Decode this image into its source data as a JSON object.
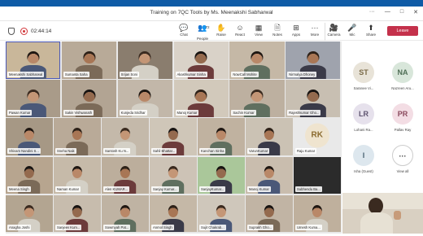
{
  "window": {
    "title": "Training on 7QC Tools by Ms. Meenakshi Sabharwal",
    "controls": [
      "···",
      "—",
      "□",
      "✕"
    ]
  },
  "call": {
    "elapsed": "02:44:14",
    "toolbar": [
      {
        "label": "Chat",
        "icon": "💬"
      },
      {
        "label": "People",
        "icon": "👥",
        "count": "72"
      },
      {
        "label": "Raise",
        "icon": "✋"
      },
      {
        "label": "React",
        "icon": "☺"
      },
      {
        "label": "View",
        "icon": "▦"
      },
      {
        "label": "Notes",
        "icon": "🗎"
      },
      {
        "label": "Apps",
        "icon": "⊞"
      },
      {
        "label": "More",
        "icon": "···"
      },
      {
        "label": "Camera",
        "icon": "🎥"
      },
      {
        "label": "Mic",
        "icon": "🎤"
      },
      {
        "label": "Share",
        "icon": "⬆"
      }
    ],
    "leave_label": "Leave",
    "leave_color": "#c4314b"
  },
  "participants": [
    {
      "name": "Meenakshi Sabharwal",
      "initials": "",
      "bg": "#c9b79a"
    },
    {
      "name": "Sumanta Saha",
      "initials": "",
      "bg": "#b8aa98"
    },
    {
      "name": "Srijan Soni",
      "initials": "",
      "bg": "#8a7d6e"
    },
    {
      "name": "Akashkumar Sinha",
      "initials": "",
      "bg": "#d9d2c8"
    },
    {
      "name": "NowCall Mohite",
      "initials": "",
      "bg": "#c5b8a6"
    },
    {
      "name": "Nirmalya Dhoney",
      "initials": "",
      "bg": "#9fa3ad"
    },
    {
      "name": "Pawan Kumar",
      "initials": "",
      "bg": "#a99b89"
    },
    {
      "name": "Sakin Vishwanath",
      "initials": "",
      "bg": "#b2a493"
    },
    {
      "name": "Kunjeda Sridhar",
      "initials": "",
      "bg": "#c2b7a9"
    },
    {
      "name": "Manoj Kumar",
      "initials": "",
      "bg": "#d2c9bb"
    },
    {
      "name": "Sachin Kumar",
      "initials": "",
      "bg": "#bdb0a0"
    },
    {
      "name": "Rajeshkumar Gho...",
      "initials": "",
      "bg": "#c8bfb2"
    },
    {
      "name": "Shivam Nandini S...",
      "initials": "",
      "bg": "#a69885"
    },
    {
      "name": "Sneha Naik",
      "initials": "",
      "bg": "#b9aa98"
    },
    {
      "name": "Santosh Ku N...",
      "initials": "",
      "bg": "#c4b9aa"
    },
    {
      "name": "Sahil Bhattar...",
      "initials": "",
      "bg": "#cfc6b8"
    },
    {
      "name": "Kanchan Sinha",
      "initials": "",
      "bg": "#c0b2a0"
    },
    {
      "name": "VarunKumar",
      "initials": "",
      "bg": "#cbc2b4"
    },
    {
      "name": "Raju Kumar",
      "initials": "RK",
      "bg": "#e9e9e9"
    },
    {
      "name": "Meena Singh",
      "initials": "",
      "bg": "#b7a58f"
    },
    {
      "name": "Naman Kumar",
      "initials": "",
      "bg": "#c6baa9"
    },
    {
      "name": "Alen KUMAR...",
      "initials": "",
      "bg": "#bcae9c"
    },
    {
      "name": "Sanjay Kumar...",
      "initials": "",
      "bg": "#cdc3b6"
    },
    {
      "name": "SanjayKumar...",
      "initials": "",
      "bg": "#aac79a"
    },
    {
      "name": "Manoj Kumar",
      "initials": "",
      "bg": "#c9bdae"
    },
    {
      "name": "Subhendu Ba...",
      "initials": "",
      "bg": "#2b2b2b"
    },
    {
      "name": "Anagha Joshi",
      "initials": "",
      "bg": "#b3a591"
    },
    {
      "name": "Sanjeev Kum...",
      "initials": "",
      "bg": "#c7bcad"
    },
    {
      "name": "Sowmyah Pat...",
      "initials": "",
      "bg": "#bfb3a3"
    },
    {
      "name": "Anmol Singh",
      "initials": "",
      "bg": "#c5b8a7"
    },
    {
      "name": "Sujit Chakrab...",
      "initials": "",
      "bg": "#cfc7bb"
    },
    {
      "name": "Suprakh Gho...",
      "initials": "",
      "bg": "#c1b4a4"
    },
    {
      "name": "Umesh Kuma...",
      "initials": "",
      "bg": "#bfb09d"
    }
  ],
  "side_panel": [
    {
      "initials": "ST",
      "label": "Saranee Vi...",
      "bg": "#e8e3d8",
      "fg": "#7a6a48"
    },
    {
      "initials": "NA",
      "label": "Nazreen Aru...",
      "bg": "#d8e6da",
      "fg": "#4f6e55"
    },
    {
      "initials": "LR",
      "label": "Lohani Ra...",
      "bg": "#e6e1ec",
      "fg": "#5f5570"
    },
    {
      "initials": "PR",
      "label": "Pallav Ray",
      "bg": "#f3dde4",
      "fg": "#8a4a5e"
    },
    {
      "initials": "I",
      "label": "Isha (Guest)",
      "bg": "#dde7ee",
      "fg": "#4a6273"
    },
    {
      "initials": "···",
      "label": "View all",
      "bg": "#ffffff",
      "fg": "#333333"
    }
  ]
}
